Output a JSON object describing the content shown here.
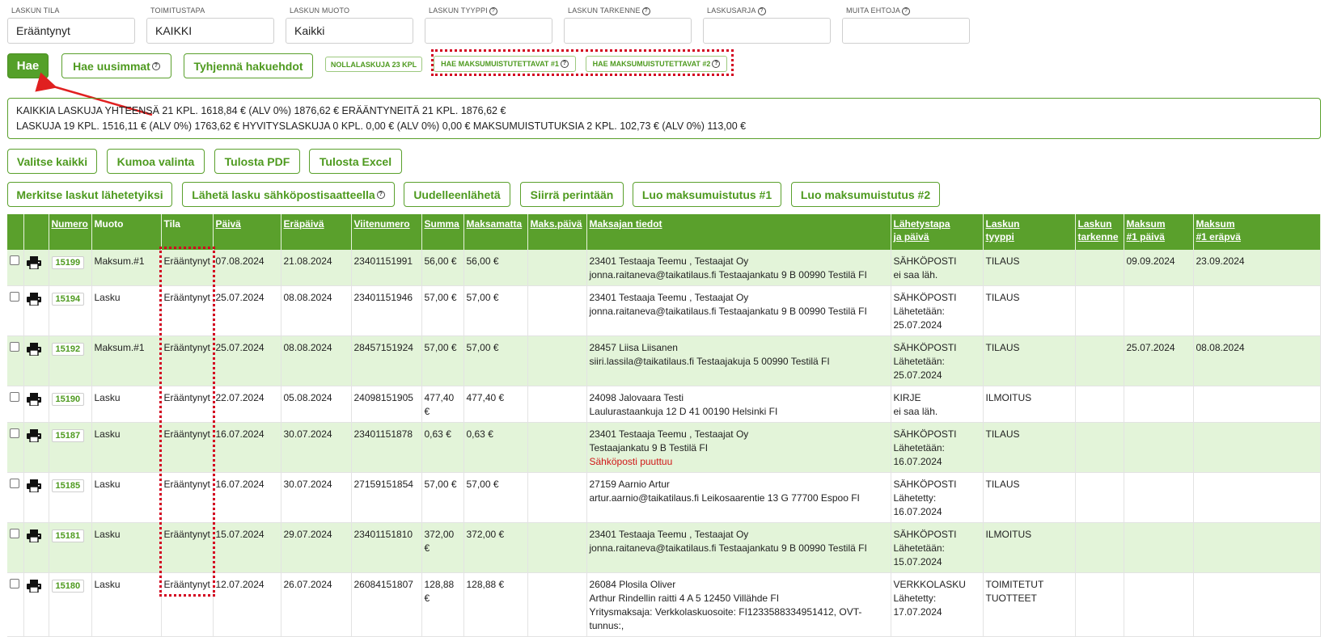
{
  "filters": [
    {
      "label": "LASKUN TILA",
      "value": "Erääntynyt",
      "help": false
    },
    {
      "label": "TOIMITUSTAPA",
      "value": "KAIKKI",
      "help": false
    },
    {
      "label": "LASKUN MUOTO",
      "value": "Kaikki",
      "help": false
    },
    {
      "label": "LASKUN TYYPPI",
      "value": "",
      "help": true
    },
    {
      "label": "LASKUN TARKENNE",
      "value": "",
      "help": true
    },
    {
      "label": "LASKUSARJA",
      "value": "",
      "help": true
    },
    {
      "label": "MUITA EHTOJA",
      "value": "",
      "help": true
    }
  ],
  "search_buttons": {
    "search": "Hae",
    "search_new": "Hae uusimmat",
    "clear": "Tyhjennä hakuehdot",
    "zero_invoices": "NOLLALASKUJA 23 KPL",
    "reminder1": "HAE MAKSUMUISTUTETTAVAT #1",
    "reminder2": "HAE MAKSUMUISTUTETTAVAT #2"
  },
  "summary": {
    "line1": "KAIKKIA LASKUJA YHTEENSÄ 21 KPL. 1618,84 € (ALV 0%)  1876,62 € ERÄÄNTYNEITÄ 21 KPL. 1876,62 €",
    "line2": "LASKUJA 19 KPL. 1516,11 € (ALV 0%)  1763,62 €   HYVITYSLASKUJA 0 KPL. 0,00 € (ALV 0%)  0,00 €   MAKSUMUISTUTUKSIA 2 KPL. 102,73 € (ALV 0%)  113,00 €"
  },
  "actions": {
    "select_all": "Valitse kaikki",
    "deselect": "Kumoa valinta",
    "print_pdf": "Tulosta PDF",
    "print_excel": "Tulosta Excel",
    "mark_sent": "Merkitse laskut lähetetyiksi",
    "send_email": "Lähetä lasku sähköpostisaatteella",
    "resend": "Uudelleenlähetä",
    "collection": "Siirrä perintään",
    "create_reminder1": "Luo maksumuistutus #1",
    "create_reminder2": "Luo maksumuistutus #2"
  },
  "table": {
    "headers": {
      "numero": "Numero",
      "muoto": "Muoto",
      "tila": "Tila",
      "paiva": "Päivä",
      "erapaiva": "Eräpäivä",
      "viite": "Viitenumero",
      "summa": "Summa",
      "maksamatta": "Maksamatta",
      "makspaiva": "Maks.päivä",
      "maksaja": "Maksajan tiedot",
      "lahetys1": "Lähetystapa",
      "lahetys2": "ja päivä",
      "tyyppi1": "Laskun",
      "tyyppi2": "tyyppi",
      "tarkenne1": "Laskun",
      "tarkenne2": "tarkenne",
      "m1paiva1": "Maksum",
      "m1paiva2": "#1 päivä",
      "m1era1": "Maksum",
      "m1era2": "#1 eräpvä"
    },
    "rows": [
      {
        "num": "15199",
        "muoto": "Maksum.#1",
        "tila": "Erääntynyt",
        "paiva": "07.08.2024",
        "erapaiva": "21.08.2024",
        "viite": "23401151991",
        "summa": "56,00 €",
        "maksamatta": "56,00 €",
        "makspaiva": "",
        "payer1": "23401 Testaaja Teemu , Testaajat Oy",
        "payer2": "jonna.raitaneva@taikatilaus.fi Testaajankatu 9 B 00990 Testilä FI",
        "payer3": "",
        "payer_warn": "",
        "send1": "SÄHKÖPOSTI",
        "send2": "ei saa läh.",
        "send3": "",
        "type1": "TILAUS",
        "type2": "",
        "tarkenne": "",
        "m1paiva": "09.09.2024",
        "m1era": "23.09.2024"
      },
      {
        "num": "15194",
        "muoto": "Lasku",
        "tila": "Erääntynyt",
        "paiva": "25.07.2024",
        "erapaiva": "08.08.2024",
        "viite": "23401151946",
        "summa": "57,00 €",
        "maksamatta": "57,00 €",
        "makspaiva": "",
        "payer1": "23401 Testaaja Teemu , Testaajat Oy",
        "payer2": "jonna.raitaneva@taikatilaus.fi Testaajankatu 9 B 00990 Testilä FI",
        "payer3": "",
        "payer_warn": "",
        "send1": "SÄHKÖPOSTI",
        "send2": "Lähetetään:",
        "send3": "25.07.2024",
        "type1": "TILAUS",
        "type2": "",
        "tarkenne": "",
        "m1paiva": "",
        "m1era": ""
      },
      {
        "num": "15192",
        "muoto": "Maksum.#1",
        "tila": "Erääntynyt",
        "paiva": "25.07.2024",
        "erapaiva": "08.08.2024",
        "viite": "28457151924",
        "summa": "57,00 €",
        "maksamatta": "57,00 €",
        "makspaiva": "",
        "payer1": "28457 Liisa Liisanen",
        "payer2": "siiri.lassila@taikatilaus.fi Testaajakuja 5 00990 Testilä FI",
        "payer3": "",
        "payer_warn": "",
        "send1": "SÄHKÖPOSTI",
        "send2": "Lähetetään:",
        "send3": "25.07.2024",
        "type1": "TILAUS",
        "type2": "",
        "tarkenne": "",
        "m1paiva": "25.07.2024",
        "m1era": "08.08.2024"
      },
      {
        "num": "15190",
        "muoto": "Lasku",
        "tila": "Erääntynyt",
        "paiva": "22.07.2024",
        "erapaiva": "05.08.2024",
        "viite": "24098151905",
        "summa": "477,40 €",
        "maksamatta": "477,40 €",
        "makspaiva": "",
        "payer1": "24098 Jalovaara Testi",
        "payer2": "Laulurastaankuja 12 D 41 00190 Helsinki FI",
        "payer3": "",
        "payer_warn": "",
        "send1": "KIRJE",
        "send2": "ei saa läh.",
        "send3": "",
        "type1": "ILMOITUS",
        "type2": "",
        "tarkenne": "",
        "m1paiva": "",
        "m1era": ""
      },
      {
        "num": "15187",
        "muoto": "Lasku",
        "tila": "Erääntynyt",
        "paiva": "16.07.2024",
        "erapaiva": "30.07.2024",
        "viite": "23401151878",
        "summa": "0,63 €",
        "maksamatta": "0,63 €",
        "makspaiva": "",
        "payer1": "23401 Testaaja Teemu , Testaajat Oy",
        "payer2": "Testaajankatu 9 B Testilä FI",
        "payer3": "",
        "payer_warn": "Sähköposti puuttuu",
        "send1": "SÄHKÖPOSTI",
        "send2": "Lähetetään:",
        "send3": "16.07.2024",
        "type1": "TILAUS",
        "type2": "",
        "tarkenne": "",
        "m1paiva": "",
        "m1era": ""
      },
      {
        "num": "15185",
        "muoto": "Lasku",
        "tila": "Erääntynyt",
        "paiva": "16.07.2024",
        "erapaiva": "30.07.2024",
        "viite": "27159151854",
        "summa": "57,00 €",
        "maksamatta": "57,00 €",
        "makspaiva": "",
        "payer1": "27159 Aarnio Artur",
        "payer2": "artur.aarnio@taikatilaus.fi Leikosaarentie 13 G 77700 Espoo FI",
        "payer3": "",
        "payer_warn": "",
        "send1": "SÄHKÖPOSTI",
        "send2": "Lähetetty:",
        "send3": "16.07.2024",
        "type1": "TILAUS",
        "type2": "",
        "tarkenne": "",
        "m1paiva": "",
        "m1era": ""
      },
      {
        "num": "15181",
        "muoto": "Lasku",
        "tila": "Erääntynyt",
        "paiva": "15.07.2024",
        "erapaiva": "29.07.2024",
        "viite": "23401151810",
        "summa": "372,00 €",
        "maksamatta": "372,00 €",
        "makspaiva": "",
        "payer1": "23401 Testaaja Teemu , Testaajat Oy",
        "payer2": "jonna.raitaneva@taikatilaus.fi Testaajankatu 9 B 00990 Testilä FI",
        "payer3": "",
        "payer_warn": "",
        "send1": "SÄHKÖPOSTI",
        "send2": "Lähetetään:",
        "send3": "15.07.2024",
        "type1": "ILMOITUS",
        "type2": "",
        "tarkenne": "",
        "m1paiva": "",
        "m1era": ""
      },
      {
        "num": "15180",
        "muoto": "Lasku",
        "tila": "Erääntynyt",
        "paiva": "12.07.2024",
        "erapaiva": "26.07.2024",
        "viite": "26084151807",
        "summa": "128,88 €",
        "maksamatta": "128,88 €",
        "makspaiva": "",
        "payer1": "26084 Plosila Oliver",
        "payer2": "Arthur Rindellin raitti 4 A 5 12450 Villähde FI",
        "payer3": "Yritysmaksaja: Verkkolaskuosoite: FI1233588334951412, OVT-tunnus:,",
        "payer_warn": "",
        "send1": "VERKKOLASKU",
        "send2": "Lähetetty:",
        "send3": "17.07.2024",
        "type1": "TOIMITETUT",
        "type2": "TUOTTEET",
        "tarkenne": "",
        "m1paiva": "",
        "m1era": ""
      }
    ]
  }
}
